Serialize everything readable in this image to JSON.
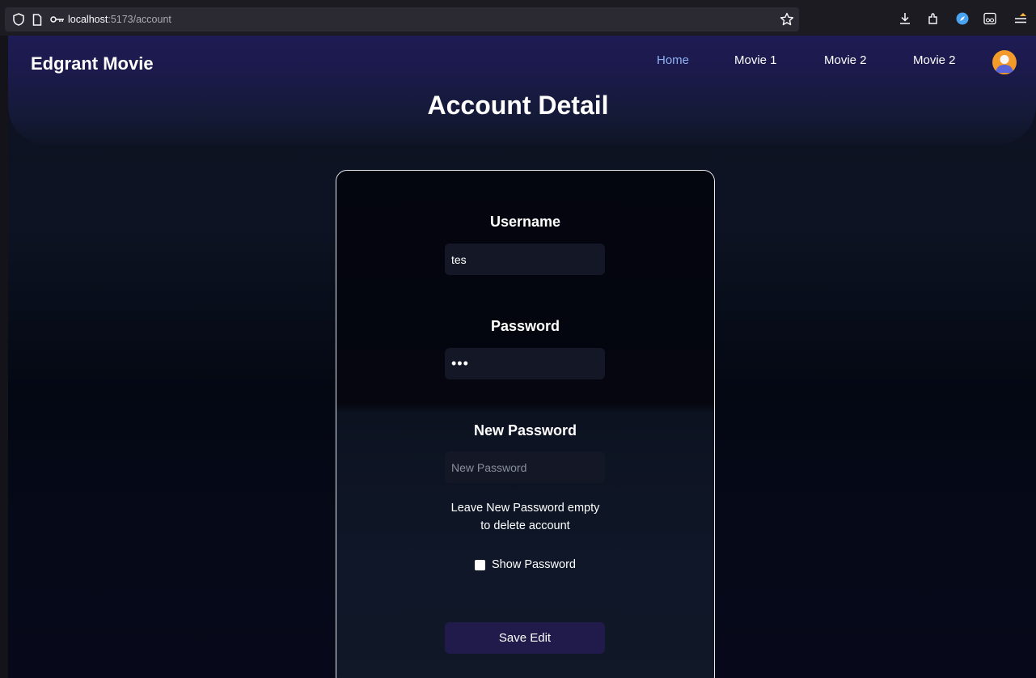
{
  "browser": {
    "url_host": "localhost",
    "url_path": ":5173/account"
  },
  "navbar": {
    "brand": "Edgrant Movie",
    "links": [
      "Home",
      "Movie 1",
      "Movie 2",
      "Movie 2"
    ],
    "active_link": "Home"
  },
  "page": {
    "title": "Account Detail"
  },
  "form": {
    "username_label": "Username",
    "username_value": "tes",
    "password_label": "Password",
    "password_value": "tes",
    "new_password_label": "New Password",
    "new_password_placeholder": "New Password",
    "hint_line1": "Leave New Password empty",
    "hint_line2": "to delete account",
    "show_password_label": "Show Password",
    "show_password_checked": false,
    "save_label": "Save Edit"
  },
  "colors": {
    "header": "#1f1b55",
    "active_link": "#8fb2f5",
    "button": "#211b4b",
    "avatar": "#f29a2a"
  }
}
